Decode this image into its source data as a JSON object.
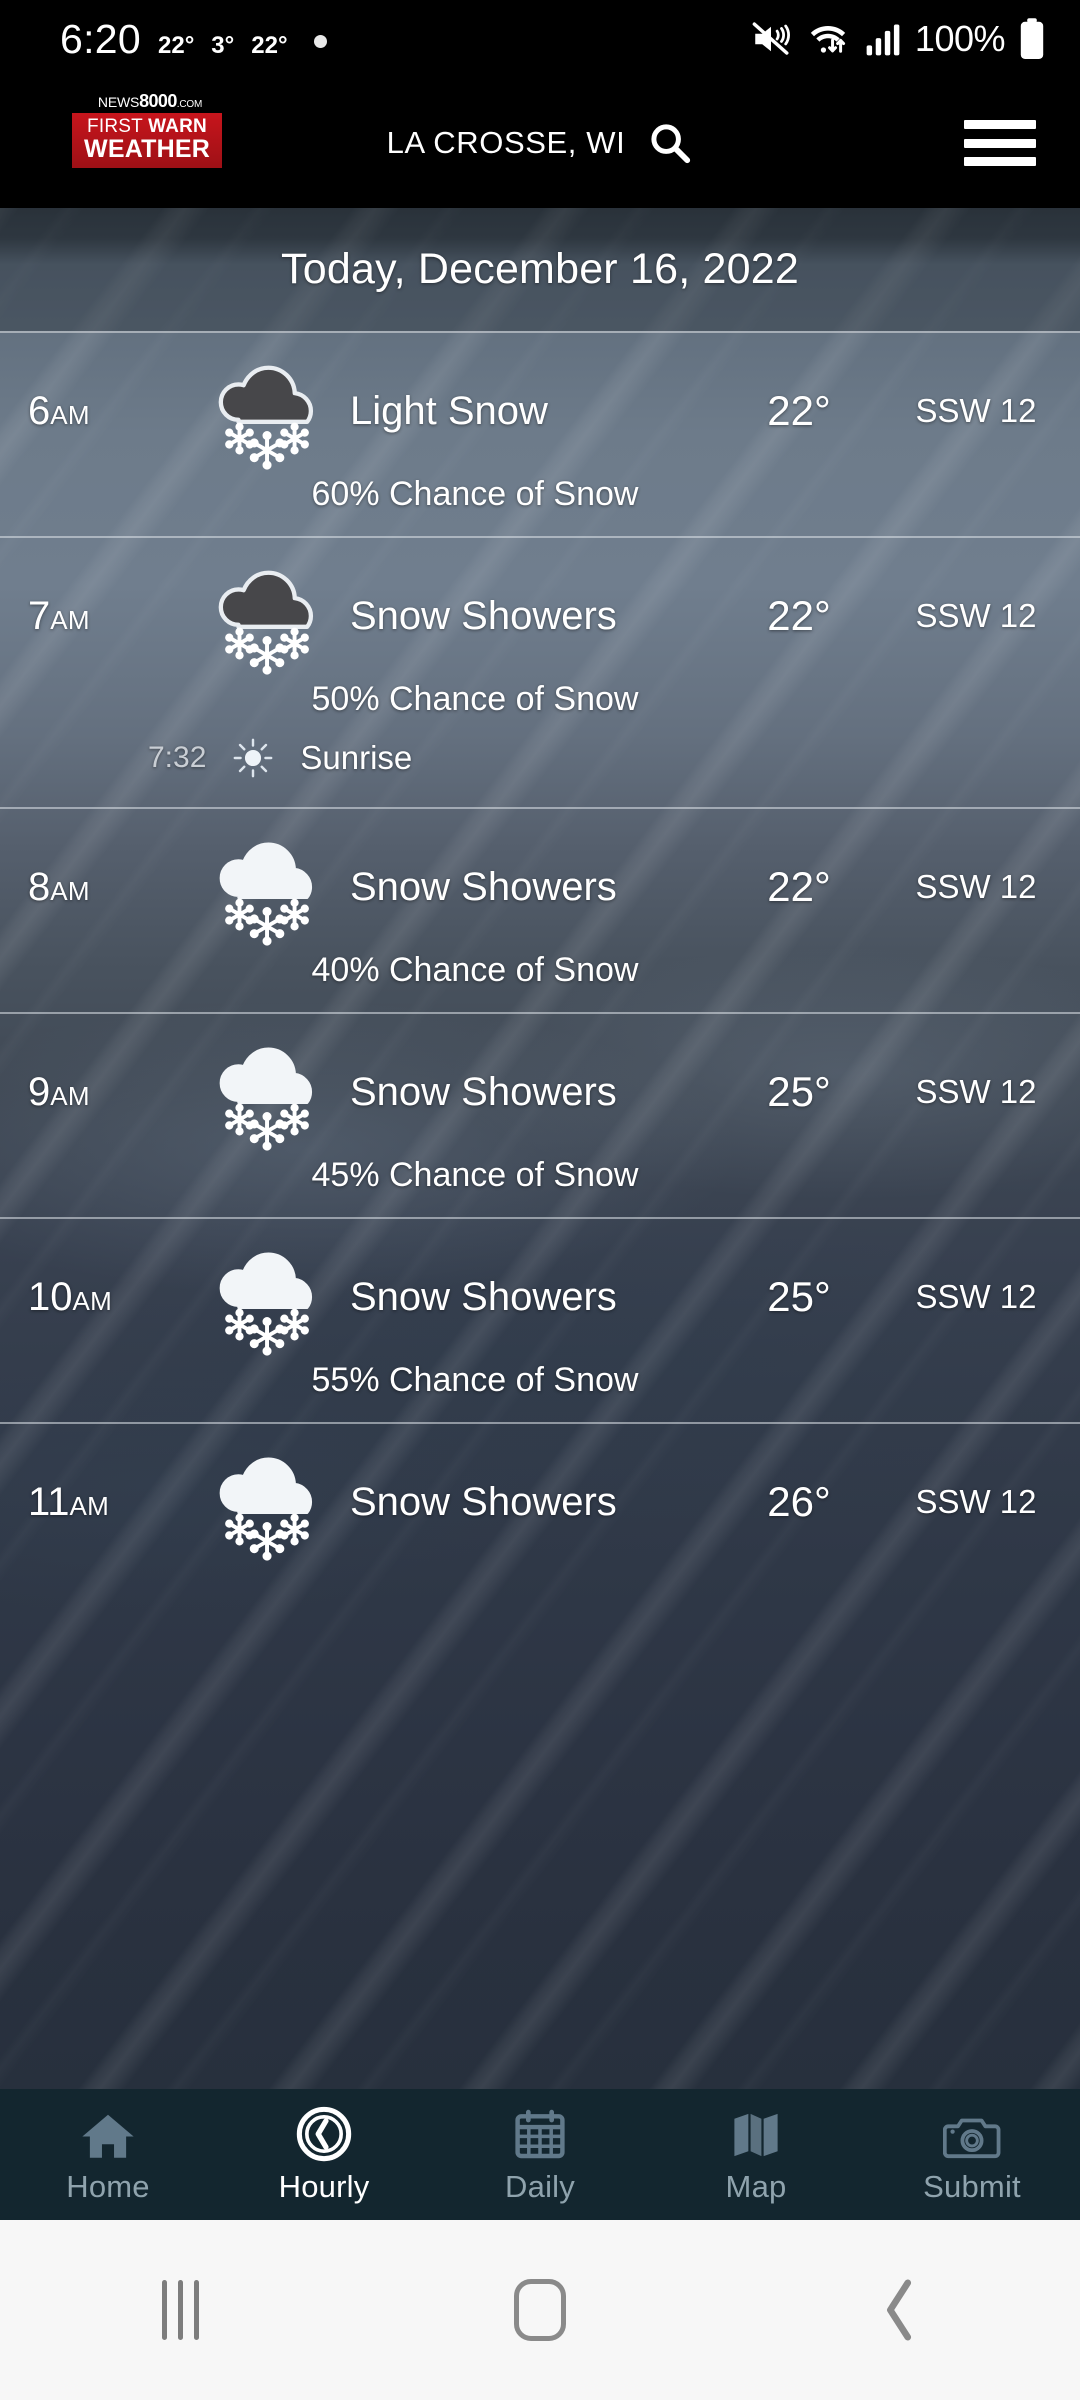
{
  "status_bar": {
    "clock": "6:20",
    "temps": [
      "22°",
      "3°",
      "22°"
    ],
    "battery_percent": "100%",
    "icons": [
      "mute-icon",
      "wifi-icon",
      "cellular-signal-icon",
      "battery-icon",
      "notification-dot-icon"
    ]
  },
  "app_header": {
    "logo_top": "NEWS",
    "logo_top_bold": "8000",
    "logo_top_suffix": ".COM",
    "logo_line1_a": "FIRST ",
    "logo_line1_b": "WARN",
    "logo_line2": "WEATHER",
    "location": "LA CROSSE, WI",
    "search_icon": "search-icon",
    "menu_icon": "hamburger-menu-icon"
  },
  "date_header": "Today, December 16, 2022",
  "hours": [
    {
      "time": "6",
      "ampm": "AM",
      "condition": "Light Snow",
      "temp": "22°",
      "wind": "SSW 12",
      "chance": "60% Chance of Snow",
      "icon": "snow-cloud-icon",
      "icon_variant": "dark"
    },
    {
      "time": "7",
      "ampm": "AM",
      "condition": "Snow Showers",
      "temp": "22°",
      "wind": "SSW 12",
      "chance": "50% Chance of Snow",
      "icon": "snow-cloud-icon",
      "icon_variant": "dark",
      "astro": {
        "time": "7:32",
        "label": "Sunrise",
        "icon": "sunrise-sun-icon"
      }
    },
    {
      "time": "8",
      "ampm": "AM",
      "condition": "Snow Showers",
      "temp": "22°",
      "wind": "SSW 12",
      "chance": "40% Chance of Snow",
      "icon": "snow-cloud-icon",
      "icon_variant": "light"
    },
    {
      "time": "9",
      "ampm": "AM",
      "condition": "Snow Showers",
      "temp": "25°",
      "wind": "SSW 12",
      "chance": "45% Chance of Snow",
      "icon": "snow-cloud-icon",
      "icon_variant": "light"
    },
    {
      "time": "10",
      "ampm": "AM",
      "condition": "Snow Showers",
      "temp": "25°",
      "wind": "SSW 12",
      "chance": "55% Chance of Snow",
      "icon": "snow-cloud-icon",
      "icon_variant": "light"
    },
    {
      "time": "11",
      "ampm": "AM",
      "condition": "Snow Showers",
      "temp": "26°",
      "wind": "SSW 12",
      "chance": "",
      "icon": "snow-cloud-icon",
      "icon_variant": "light"
    }
  ],
  "tabs": [
    {
      "label": "Home",
      "icon": "home-icon",
      "active": false
    },
    {
      "label": "Hourly",
      "icon": "clock-icon",
      "active": true
    },
    {
      "label": "Daily",
      "icon": "calendar-icon",
      "active": false
    },
    {
      "label": "Map",
      "icon": "map-icon",
      "active": false
    },
    {
      "label": "Submit",
      "icon": "camera-icon",
      "active": false
    }
  ],
  "android_nav": {
    "recents": "recents-icon",
    "home": "home-button-icon",
    "back": "back-icon"
  },
  "colors": {
    "brand_red": "#c7151c",
    "tabbar_bg": "#13262f",
    "tab_inactive": "#8fa3ad",
    "tab_active": "#ffffff"
  }
}
